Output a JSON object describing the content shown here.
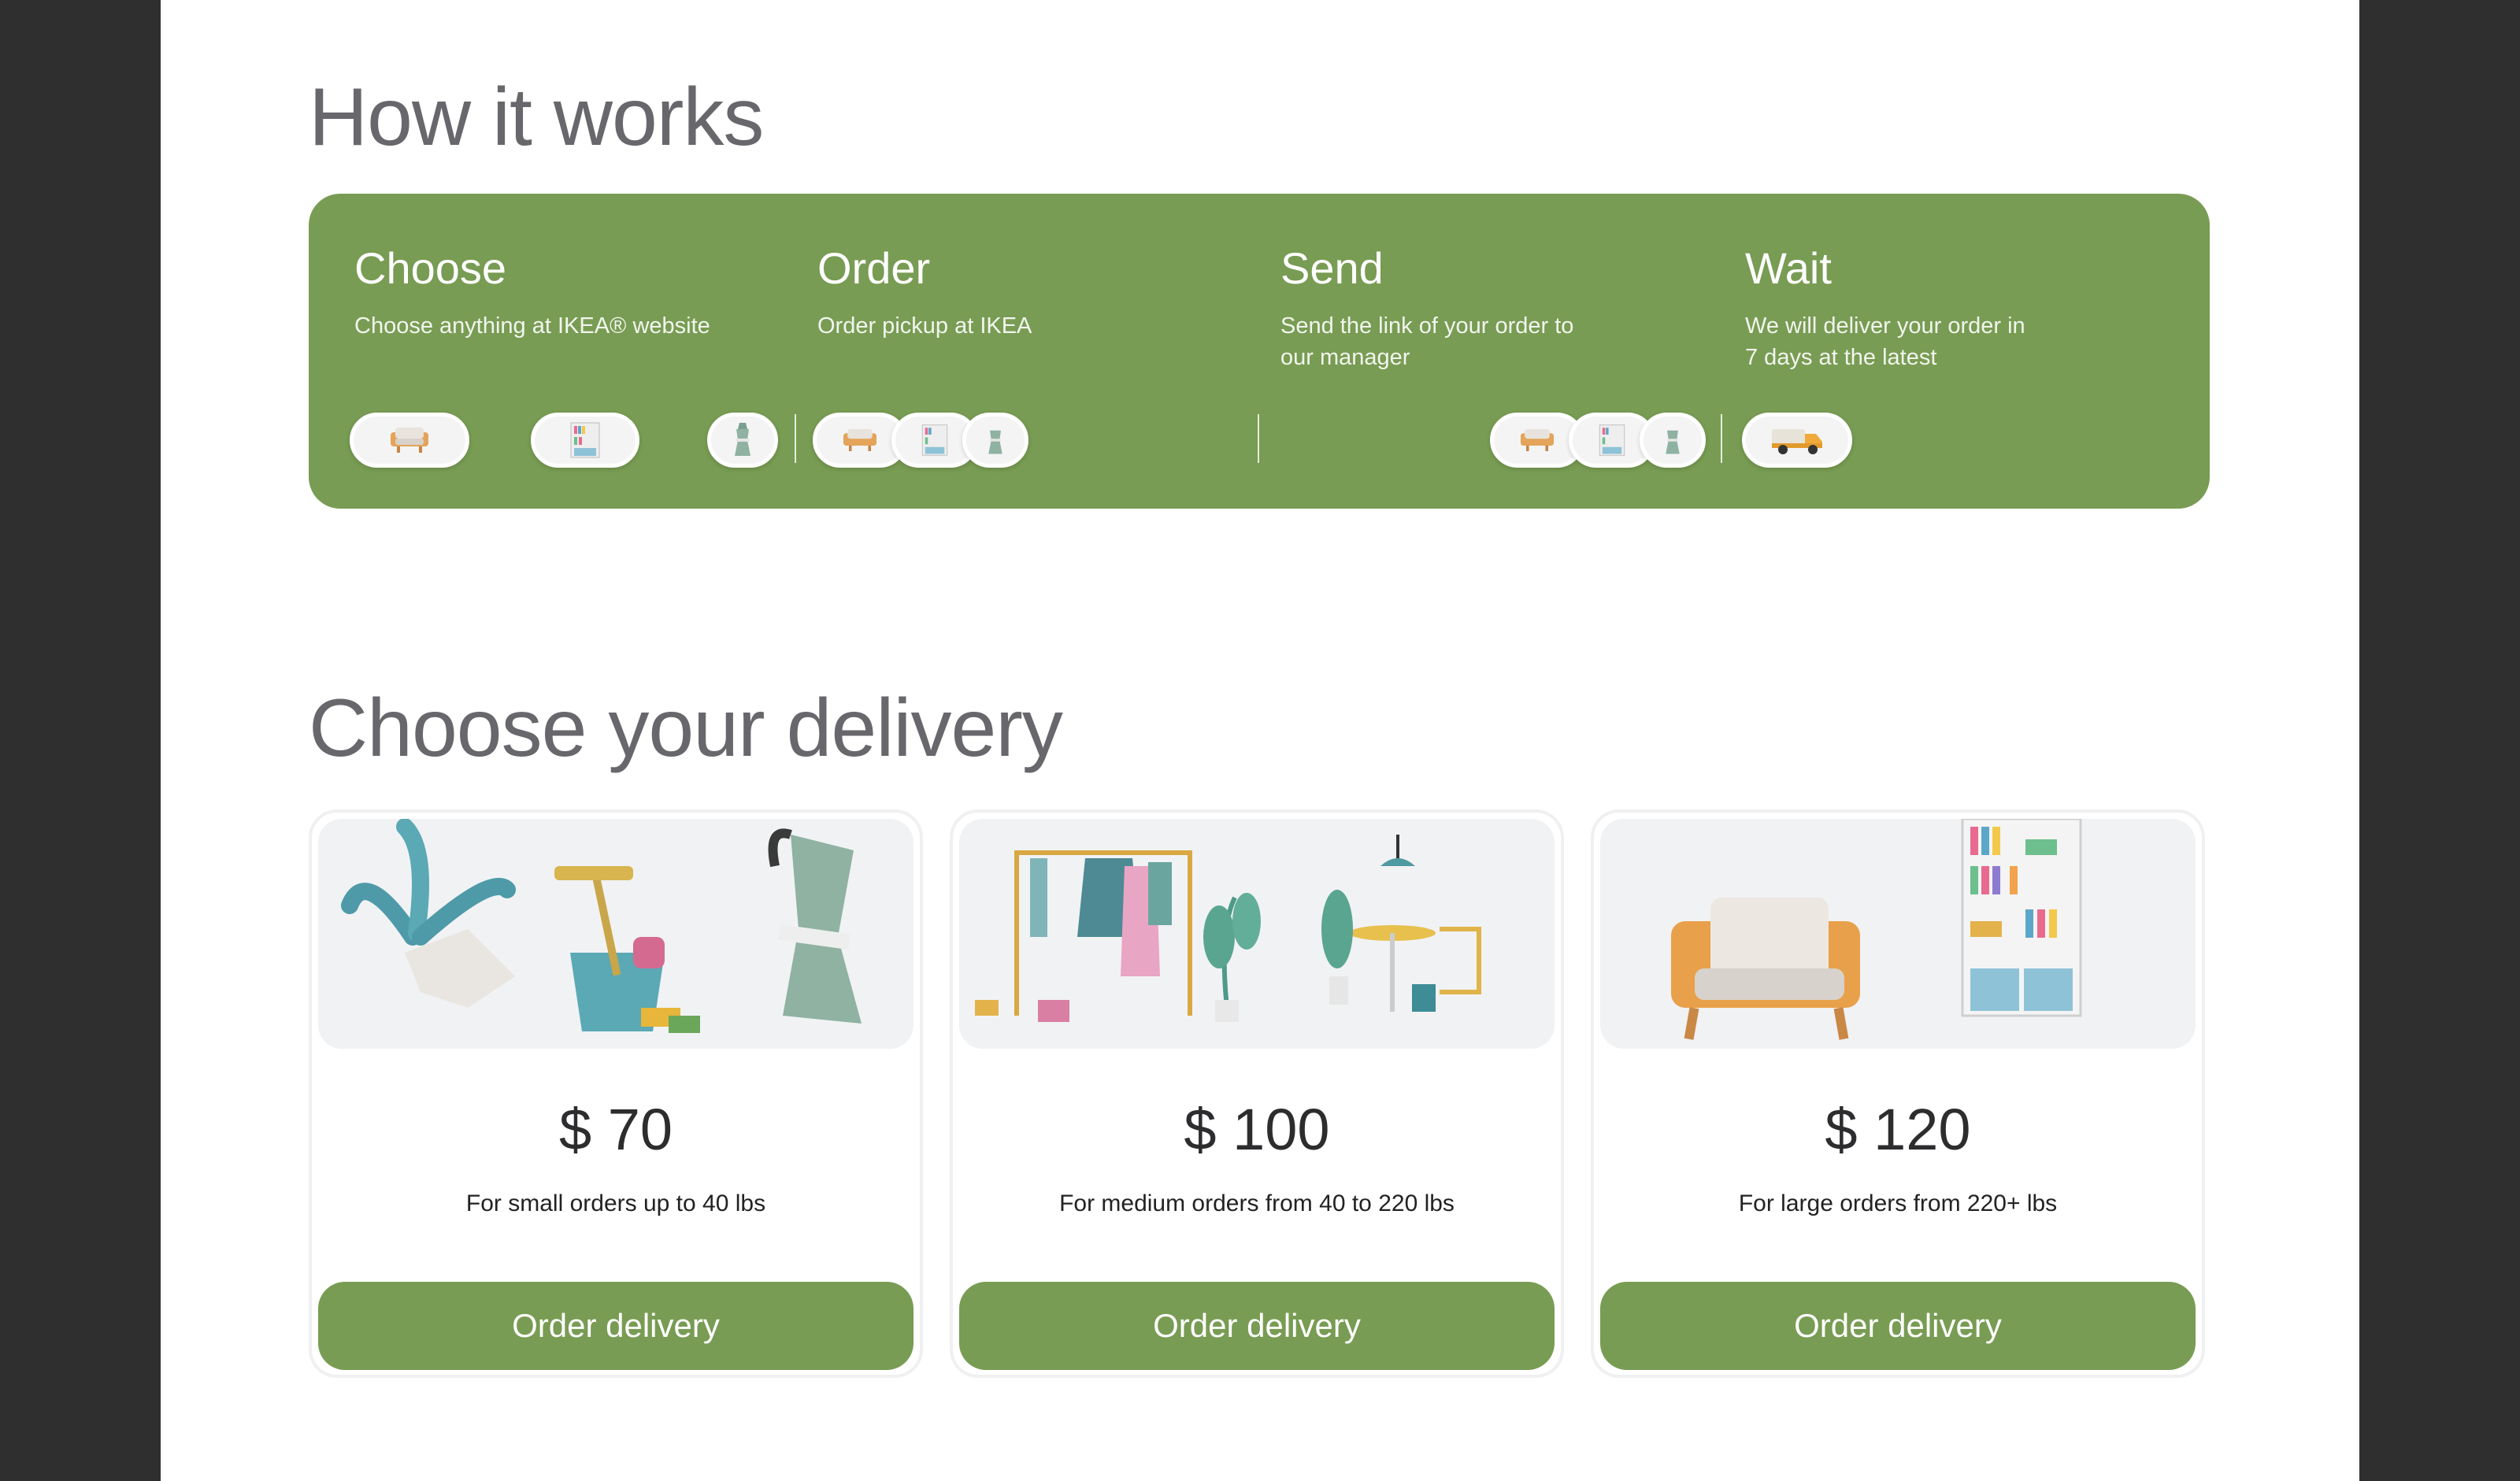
{
  "how_it_works": {
    "title": "How it works",
    "steps": [
      {
        "title": "Choose",
        "description": "Choose anything at IKEA® website"
      },
      {
        "title": "Order",
        "description": "Order pickup at IKEA"
      },
      {
        "title": "Send",
        "description": "Send the link of your order to our manager"
      },
      {
        "title": "Wait",
        "description": "We will deliver your order in 7 days at the latest"
      }
    ]
  },
  "delivery": {
    "title": "Choose your delivery",
    "plans": [
      {
        "price": "$ 70",
        "description": "For small orders up to 40 lbs",
        "button": "Order delivery"
      },
      {
        "price": "$ 100",
        "description": "For medium orders from 40 to 220 lbs",
        "button": "Order delivery"
      },
      {
        "price": "$ 120",
        "description": "For large orders from 220+ lbs",
        "button": "Order delivery"
      }
    ]
  },
  "colors": {
    "brand_green": "#789c53",
    "heading_gray": "#67676c",
    "card_image_bg": "#f1f2f4"
  },
  "icons": [
    "armchair-icon",
    "bookshelf-icon",
    "coffee-pot-icon",
    "delivery-truck-icon",
    "plant-icon",
    "bucket-icon",
    "clothes-rack-icon",
    "cafe-table-icon"
  ]
}
